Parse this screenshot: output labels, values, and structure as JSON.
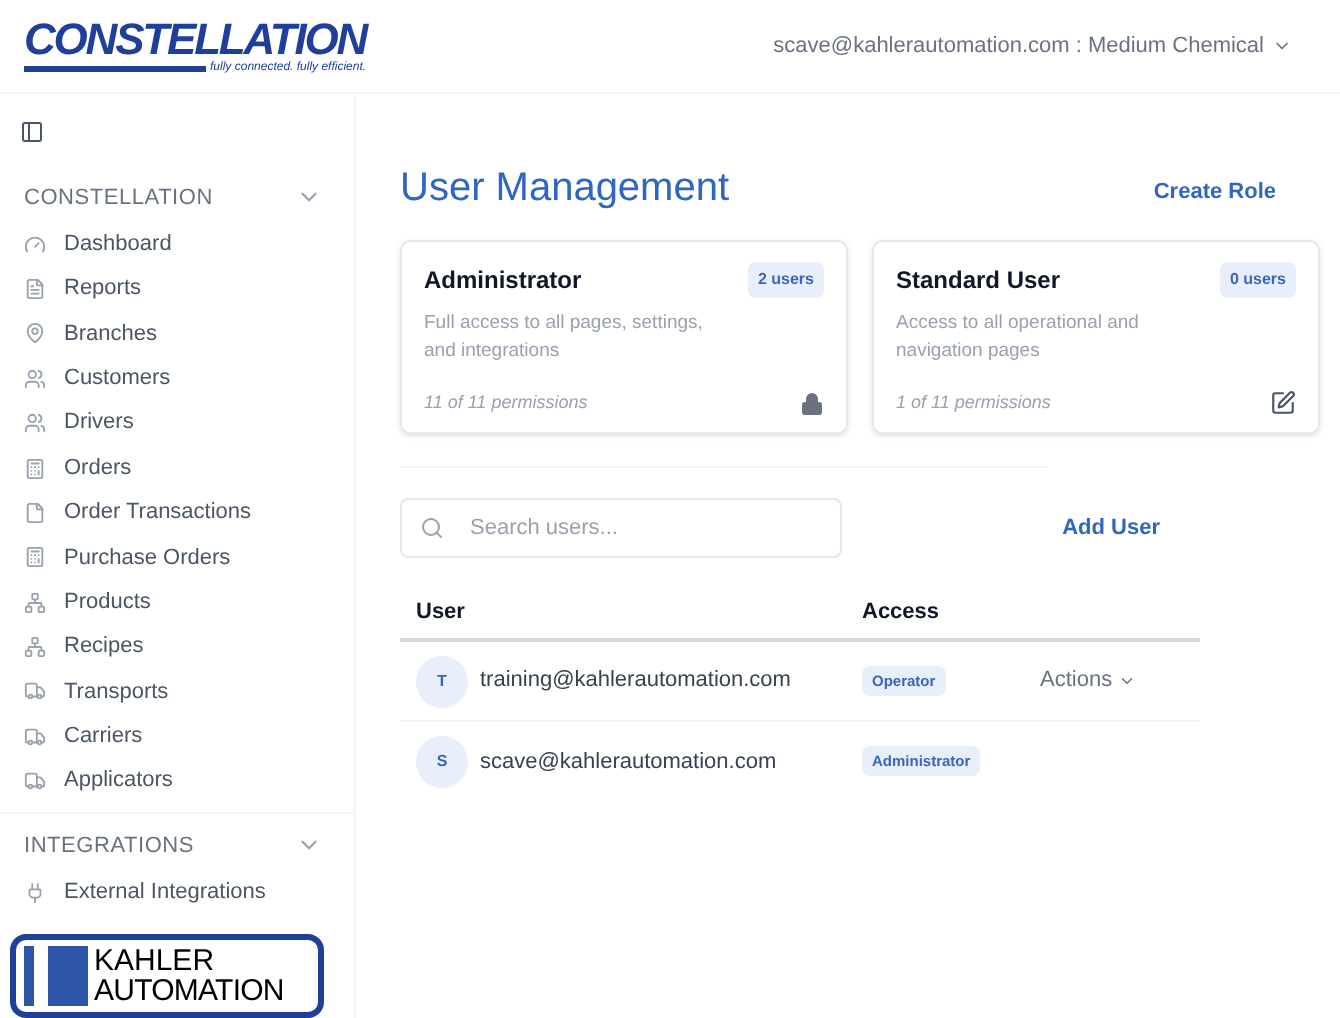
{
  "header": {
    "logo": {
      "name": "CONSTELLATION",
      "tagline": "fully connected. fully efficient."
    },
    "account": "scave@kahlerautomation.com : Medium Chemical"
  },
  "sidebar": {
    "sections": [
      {
        "title": "CONSTELLATION",
        "expanded": true,
        "items": [
          {
            "label": "Dashboard"
          },
          {
            "label": "Reports"
          },
          {
            "label": "Branches"
          },
          {
            "label": "Customers"
          },
          {
            "label": "Drivers"
          },
          {
            "label": "Orders"
          },
          {
            "label": "Order Transactions"
          },
          {
            "label": "Purchase Orders"
          },
          {
            "label": "Products"
          },
          {
            "label": "Recipes"
          },
          {
            "label": "Transports"
          },
          {
            "label": "Carriers"
          },
          {
            "label": "Applicators"
          }
        ]
      },
      {
        "title": "INTEGRATIONS",
        "expanded": true,
        "items": [
          {
            "label": "External Integrations"
          }
        ]
      }
    ],
    "footer_logo": {
      "line_1": "KAHLER",
      "line_2": "AUTOMATION"
    }
  },
  "page": {
    "title": "User Management",
    "create_role": "Create Role",
    "roles": [
      {
        "name": "Administrator",
        "users": "2 users",
        "description": "Full access to all pages, settings, and integrations",
        "permissions": "11 of 11 permissions",
        "kind": "locked"
      },
      {
        "name": "Standard User",
        "users": "0 users",
        "description": "Access to all operational and navigation pages",
        "permissions": "1 of 11 permissions",
        "kind": "editable"
      }
    ],
    "search": {
      "placeholder": "Search users..."
    },
    "add_user": "Add User",
    "table": {
      "columns": [
        "User",
        "Access"
      ],
      "rows": [
        {
          "initial": "T",
          "email": "training@kahlerautomation.com",
          "access": "Operator",
          "actions": "Actions"
        },
        {
          "initial": "S",
          "email": "scave@kahlerautomation.com",
          "access": "Administrator"
        }
      ]
    }
  }
}
